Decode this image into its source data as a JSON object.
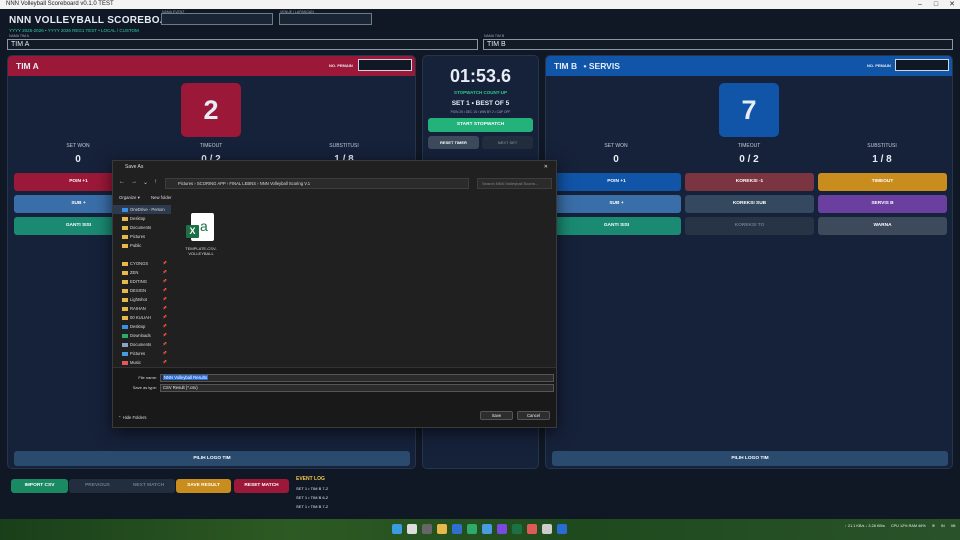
{
  "window": {
    "title": "NNN Volleyball Scoreboard v0.1.0 TEST"
  },
  "app": {
    "title": "NNN VOLLEYBALL SCOREBOARD",
    "subtitle": "YYYY 2025-2026 • YYYY 2026 REG1 TEST • LOCAL / CUSTOM",
    "field1_label": "NAMA EVENT",
    "field2_label": "VENUE / LAPANGAN",
    "team_a_label": "NAMA TIM A",
    "team_b_label": "NAMA TIM B"
  },
  "team_a": {
    "name": "TIM A",
    "header": "TIM A",
    "player_no_label": "NO. PEMAIN",
    "score": "2",
    "stats": [
      {
        "label": "SET WON",
        "value": "0"
      },
      {
        "label": "TIMEOUT",
        "value": "0 / 2"
      },
      {
        "label": "SUBSTITUSI",
        "value": "1 / 8"
      }
    ],
    "buttons": {
      "point": "POIN +1",
      "sub": "SUB +",
      "switch": "GANTI SISI",
      "logo": "PILIH LOGO TIM"
    }
  },
  "team_b": {
    "name": "TIM B",
    "header": "TIM B",
    "serve": "• SERVIS",
    "player_no_label": "NO. PEMAIN",
    "score": "7",
    "stats": [
      {
        "label": "SET WON",
        "value": "0"
      },
      {
        "label": "TIMEOUT",
        "value": "0 / 2"
      },
      {
        "label": "SUBSTITUSI",
        "value": "1 / 8"
      }
    ],
    "buttons": {
      "point": "POIN +1",
      "correction": "KOREKSI -1",
      "timeout": "TIMEOUT",
      "sub": "SUB +",
      "corr_sub": "KOREKSI SUB",
      "serve": "SERVIS B",
      "switch": "GANTI SISI",
      "corr_to": "KOREKSI TO",
      "color": "WARNA",
      "logo": "PILIH LOGO TIM"
    }
  },
  "timer": {
    "time": "01:53.6",
    "mode": "STOPWATCH COUNT-UP",
    "set_info": "SET 1 • BEST OF 5",
    "set_sub": "POIN 25 • DEC 15 • WIN BY 2 • CAP OFF",
    "start": "START STOPWATCH",
    "reset": "RESET TIMER",
    "next_set": "NEXT SET"
  },
  "bottom": {
    "import": "IMPORT CSV",
    "previous": "PREVIOUS",
    "next_match": "NEXT MATCH",
    "save": "SAVE RESULT",
    "reset": "RESET MATCH"
  },
  "event_log": {
    "title": "EVENT LOG",
    "entries": [
      "SET 1 • TIM B 7-2",
      "SET 1 • TIM B 6-2",
      "SET 1 • TIM B 7-2"
    ]
  },
  "dialog": {
    "title": "Save As",
    "path": [
      "Pictures",
      "SCORING APP",
      "FINAL LEBNS",
      "NNN Volleyball Scoring V.1"
    ],
    "search_placeholder": "Search NNN Volleyball Scorin...",
    "organize": "Organize ▾",
    "new_folder": "New folder",
    "sidebar": [
      {
        "label": "OneDrive - Person",
        "pin": false
      },
      {
        "label": "Desktop",
        "pin": false
      },
      {
        "label": "Documents",
        "pin": false
      },
      {
        "label": "Pictures",
        "pin": false
      },
      {
        "label": "Public",
        "pin": false
      },
      {
        "label": "",
        "pin": false
      },
      {
        "label": "CYONGS",
        "pin": true
      },
      {
        "label": "ZEN",
        "pin": true
      },
      {
        "label": "EDITING",
        "pin": true
      },
      {
        "label": "DESIGN",
        "pin": true
      },
      {
        "label": "Lightshot",
        "pin": true
      },
      {
        "label": "RAIHAN",
        "pin": true
      },
      {
        "label": "00 KULIAH",
        "pin": true
      },
      {
        "label": "Desktop",
        "pin": true
      },
      {
        "label": "Downloads",
        "pin": true
      },
      {
        "label": "Documents",
        "pin": true
      },
      {
        "label": "Pictures",
        "pin": true
      },
      {
        "label": "Music",
        "pin": true
      }
    ],
    "file": {
      "name": "TEMPLATE-CSV-VOLLEYBALL"
    },
    "filename_label": "File name:",
    "filename": "NNN Volleyball Results",
    "type_label": "Save as type:",
    "type": "CSV Result (*.csv)",
    "hide_folders": "Hide Folders",
    "save": "Save",
    "cancel": "Cancel"
  },
  "taskbar": {
    "net": "↑ 21.1 KB/s ↓ 3.28 KB/s",
    "cpu": "CPU 12% RAM 46%",
    "lang": "IN",
    "time": "08:"
  },
  "colors": {
    "team_a": "#9c1838",
    "team_b": "#1055a8",
    "accent": "#2ecc8a",
    "gold": "#c98d1e"
  }
}
